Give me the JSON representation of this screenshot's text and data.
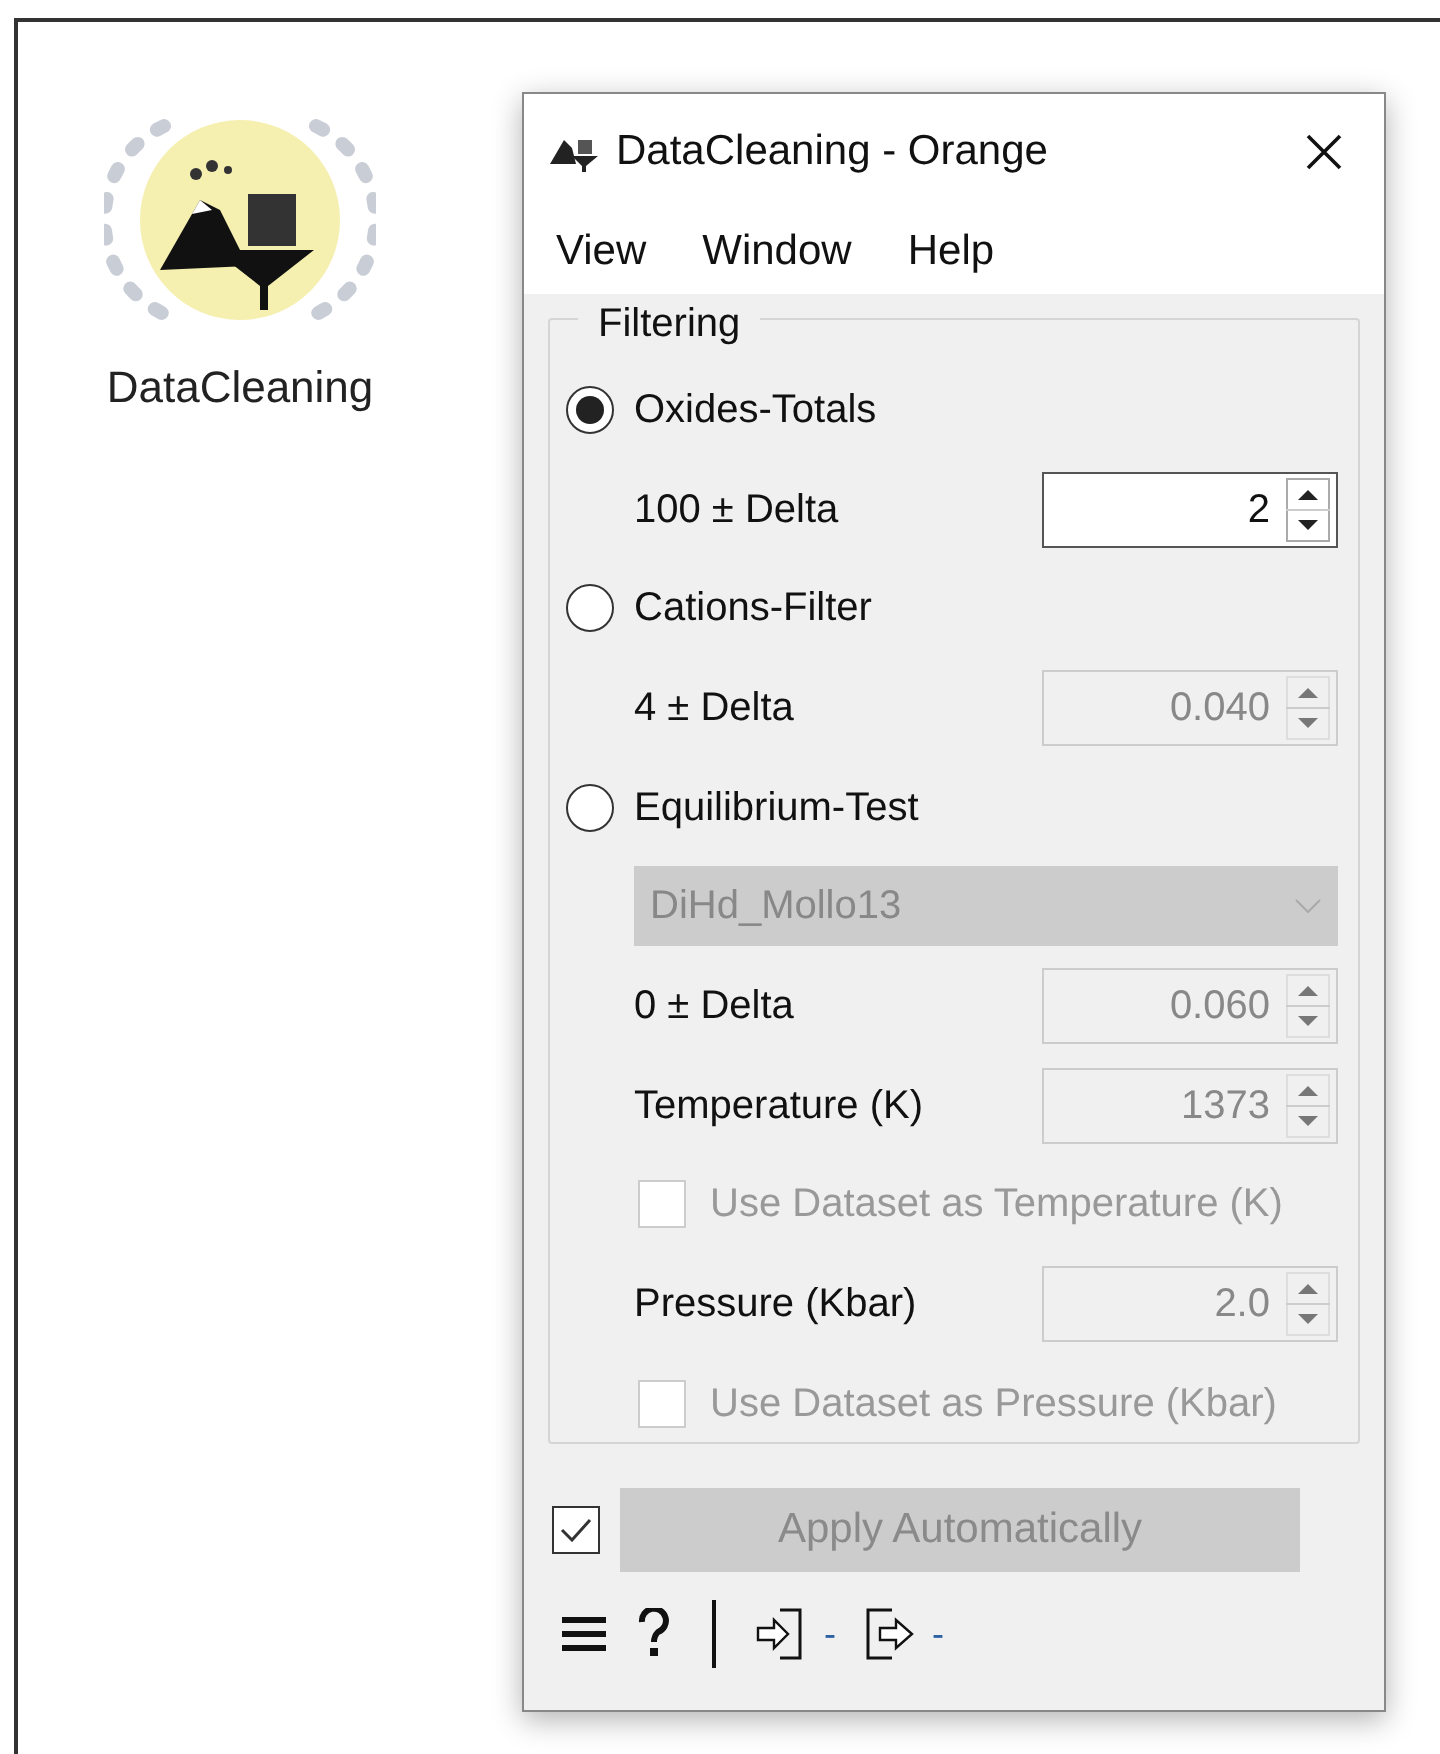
{
  "canvas": {
    "node": {
      "label": "DataCleaning"
    }
  },
  "window": {
    "title": "DataCleaning - Orange"
  },
  "menu": [
    "View",
    "Window",
    "Help"
  ],
  "group": {
    "title": "Filtering"
  },
  "rows": [
    {
      "kind": "radio",
      "label": "Oxides-Totals",
      "selected": true
    },
    {
      "kind": "spin",
      "label": "100 ± Delta",
      "value": "2",
      "disabled": false
    },
    {
      "kind": "radio",
      "label": "Cations-Filter",
      "selected": false
    },
    {
      "kind": "spin",
      "label": "4 ± Delta",
      "value": "0.040",
      "disabled": true
    },
    {
      "kind": "radio",
      "label": "Equilibrium-Test",
      "selected": false
    },
    {
      "kind": "combo",
      "value": "DiHd_Mollo13",
      "disabled": true
    },
    {
      "kind": "spin",
      "label": "0 ± Delta",
      "value": "0.060",
      "disabled": true
    },
    {
      "kind": "spin",
      "label": "Temperature (K)",
      "value": "1373",
      "disabled": true
    },
    {
      "kind": "checkbox",
      "label": "Use Dataset as Temperature (K)",
      "checked": false,
      "disabled": true
    },
    {
      "kind": "spin",
      "label": "Pressure (Kbar)",
      "value": "2.0",
      "disabled": true
    },
    {
      "kind": "checkbox",
      "label": "Use Dataset as Pressure (Kbar)",
      "checked": false,
      "disabled": true
    }
  ],
  "auto_apply": {
    "checked": true,
    "label": "Apply Automatically",
    "disabled": true
  },
  "status": {
    "input": "-",
    "output": "-"
  }
}
